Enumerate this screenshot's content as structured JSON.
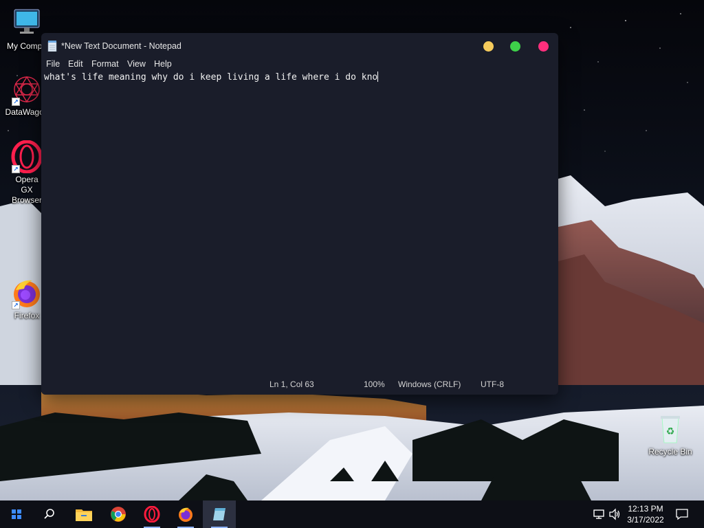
{
  "desktop": {
    "icons": [
      {
        "label": "My Compu",
        "icon": "monitor-icon"
      },
      {
        "label": "DataWagon",
        "icon": "datawagon-icon"
      },
      {
        "label": "Opera GX Browser",
        "icon": "opera-gx-icon"
      },
      {
        "label": "Firefox",
        "icon": "firefox-icon"
      },
      {
        "label": "Recycle Bin",
        "icon": "recycle-bin-icon"
      }
    ]
  },
  "notepad": {
    "title": "*New Text Document - Notepad",
    "menu": [
      "File",
      "Edit",
      "Format",
      "View",
      "Help"
    ],
    "content": "what's life meaning why do i keep living a life where i do kno",
    "status": {
      "position": "Ln 1, Col 63",
      "zoom": "100%",
      "line_ending": "Windows (CRLF)",
      "encoding": "UTF-8"
    },
    "colors": {
      "minimize": "#f5cb5c",
      "maximize": "#3ed14a",
      "close": "#ff2f7d",
      "background": "#1a1d2a"
    }
  },
  "taskbar": {
    "apps": [
      "start-icon",
      "search-icon",
      "file-explorer-icon",
      "chrome-icon",
      "opera-icon",
      "firefox-icon",
      "notepad-icon"
    ],
    "clock": {
      "time": "12:13 PM",
      "date": "3/17/2022"
    }
  }
}
